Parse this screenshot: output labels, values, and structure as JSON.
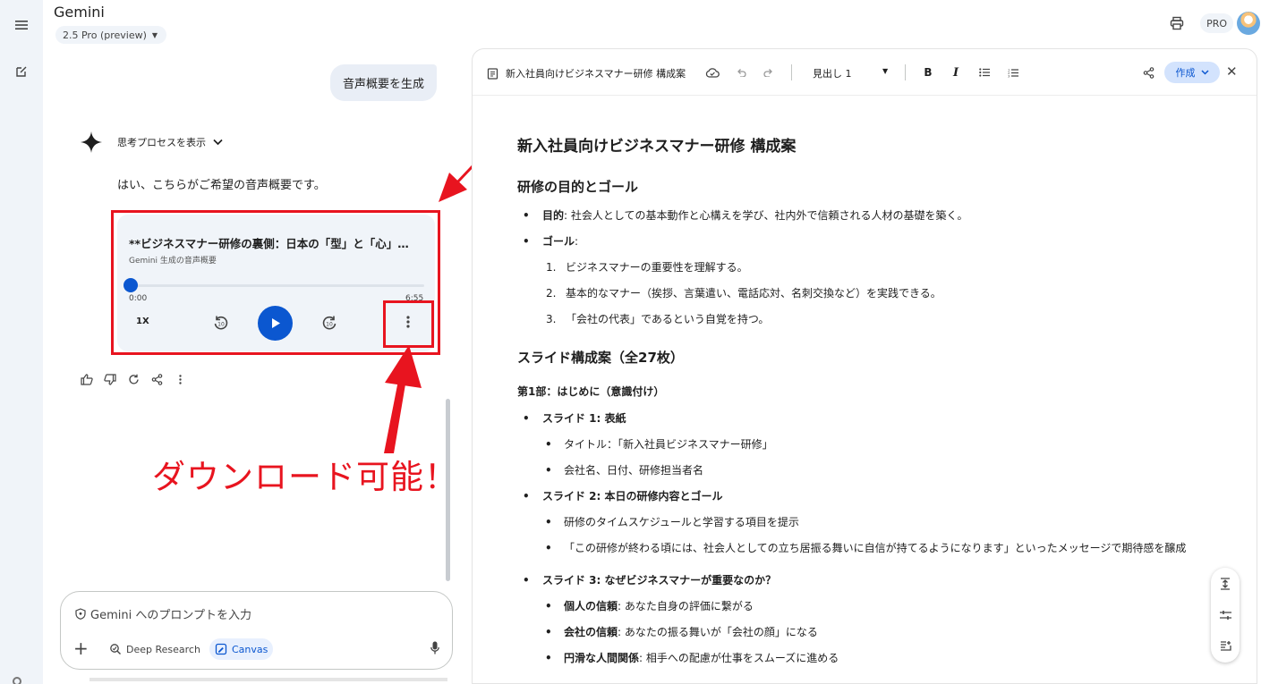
{
  "app": {
    "title": "Gemini",
    "model": "2.5 Pro (preview)",
    "plan_badge": "PRO"
  },
  "icons": {
    "rail": [
      "menu-icon",
      "new-chat-icon",
      "settings-icon"
    ],
    "header": [
      "print-icon",
      "avatar"
    ],
    "audio": [
      "rewind-10-icon",
      "play-icon",
      "forward-10-icon",
      "more-vert-icon"
    ],
    "response_actions": [
      "thumb-up-icon",
      "thumb-down-icon",
      "refresh-icon",
      "share-icon",
      "more-vert-icon"
    ],
    "canvas_toolbar": [
      "document-icon",
      "cloud-save-icon",
      "undo-icon",
      "redo-icon",
      "bold-icon",
      "italic-icon",
      "bullet-list-icon",
      "numbered-list-icon",
      "share-icon",
      "close-icon"
    ],
    "floating_tools": [
      "expand-icon",
      "tune-icon",
      "insert-icon"
    ]
  },
  "chat": {
    "user_message": "音声概要を生成",
    "thinking_toggle": "思考プロセスを表示",
    "reply": "はい、こちらがご希望の音声概要です。",
    "audio": {
      "title": "**ビジネスマナー研修の裏側：日本の「型」と「心」…",
      "subtitle": "Gemini 生成の音声概要",
      "current_time": "0:00",
      "duration": "6:55",
      "speed": "1X",
      "progress": 0
    }
  },
  "annotation": {
    "text": "ダウンロード可能！",
    "color": "#e8141f"
  },
  "prompt": {
    "placeholder": "Gemini へのプロンプトを入力",
    "chips": {
      "deep_research": "Deep Research",
      "canvas": "Canvas"
    }
  },
  "canvas": {
    "doc_title": "新入社員向けビジネスマナー研修 構成案",
    "style_select": "見出し 1",
    "create_button": "作成",
    "bold_btn": "B",
    "italic_btn": "I",
    "content": {
      "h1": "新入社員向けビジネスマナー研修 構成案",
      "section1": {
        "heading": "研修の目的とゴール",
        "purpose_label": "目的",
        "purpose_text": ": 社会人としての基本動作と心構えを学び、社内外で信頼される人材の基礎を築く。",
        "goal_label": "ゴール",
        "goal_text": ":",
        "goals": [
          "ビジネスマナーの重要性を理解する。",
          "基本的なマナー（挨拶、言葉遣い、電話応対、名刺交換など）を実践できる。",
          "「会社の代表」であるという自覚を持つ。"
        ]
      },
      "section2": {
        "heading": "スライド構成案（全27枚）",
        "part1": "第1部：はじめに（意識付け）",
        "slides": [
          {
            "title": "スライド 1: 表紙",
            "items": [
              "タイトル：「新入社員ビジネスマナー研修」",
              "会社名、日付、研修担当者名"
            ]
          },
          {
            "title": "スライド 2: 本日の研修内容とゴール",
            "items": [
              "研修のタイムスケジュールと学習する項目を提示",
              "「この研修が終わる頃には、社会人としての立ち居振る舞いに自信が持てるようになります」といったメッセージで期待感を醸成"
            ]
          }
        ],
        "slide3": {
          "title": "スライド 3: なぜビジネスマナーが重要なのか？",
          "items": [
            {
              "label": "個人の信頼",
              "text": ": あなた自身の評価に繋がる"
            },
            {
              "label": "会社の信頼",
              "text": ": あなたの振る舞いが「会社の顔」になる"
            },
            {
              "label": "円滑な人間関係",
              "text": ": 相手への配慮が仕事をスムーズに進める"
            }
          ]
        }
      }
    }
  }
}
